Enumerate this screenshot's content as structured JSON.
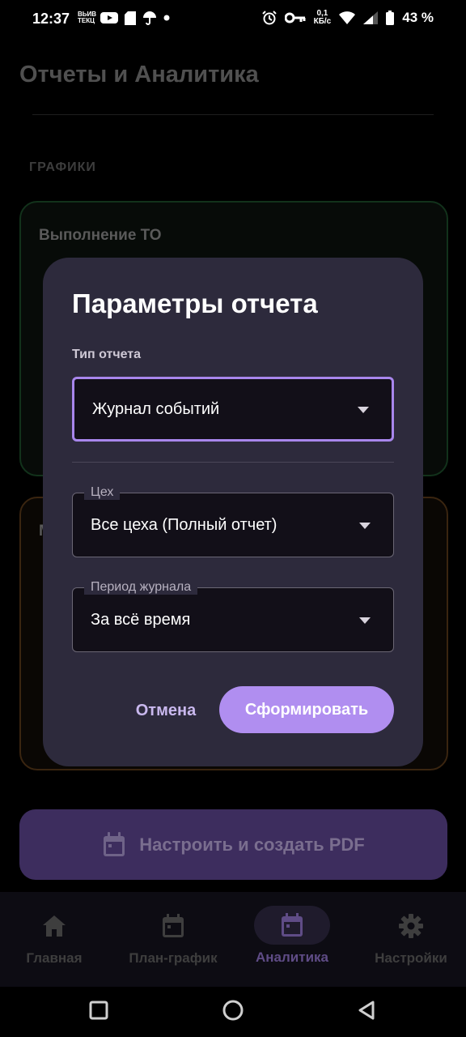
{
  "status_bar": {
    "time": "12:37",
    "notif_tiny": "ВЬИВ\nТЕКЦ",
    "net_speed_value": "0,1",
    "net_speed_unit": "КБ/с",
    "battery": "43 %"
  },
  "page": {
    "title": "Отчеты и Аналитика",
    "section_label": "ГРАФИКИ",
    "card1_title": "Выполнение ТО",
    "card2_title": "М",
    "pdf_button_label": "Настроить и создать PDF"
  },
  "dialog": {
    "title": "Параметры отчета",
    "report_type_caption": "Тип отчета",
    "report_type_value": "Журнал событий",
    "workshop_label": "Цех",
    "workshop_value": "Все цеха (Полный отчет)",
    "period_label": "Период журнала",
    "period_value": "За всё время",
    "cancel_label": "Отмена",
    "submit_label": "Сформировать"
  },
  "bottom_nav": {
    "items": [
      {
        "label": "Главная",
        "icon": "home-icon",
        "active": false
      },
      {
        "label": "План-график",
        "icon": "calendar-icon",
        "active": false
      },
      {
        "label": "Аналитика",
        "icon": "calendar-icon",
        "active": true
      },
      {
        "label": "Настройки",
        "icon": "gear-icon",
        "active": false
      }
    ]
  },
  "colors": {
    "accent": "#b08ef0",
    "dialog_bg": "#2d2a3c",
    "pdf_button_bg": "#3d2d5e"
  }
}
